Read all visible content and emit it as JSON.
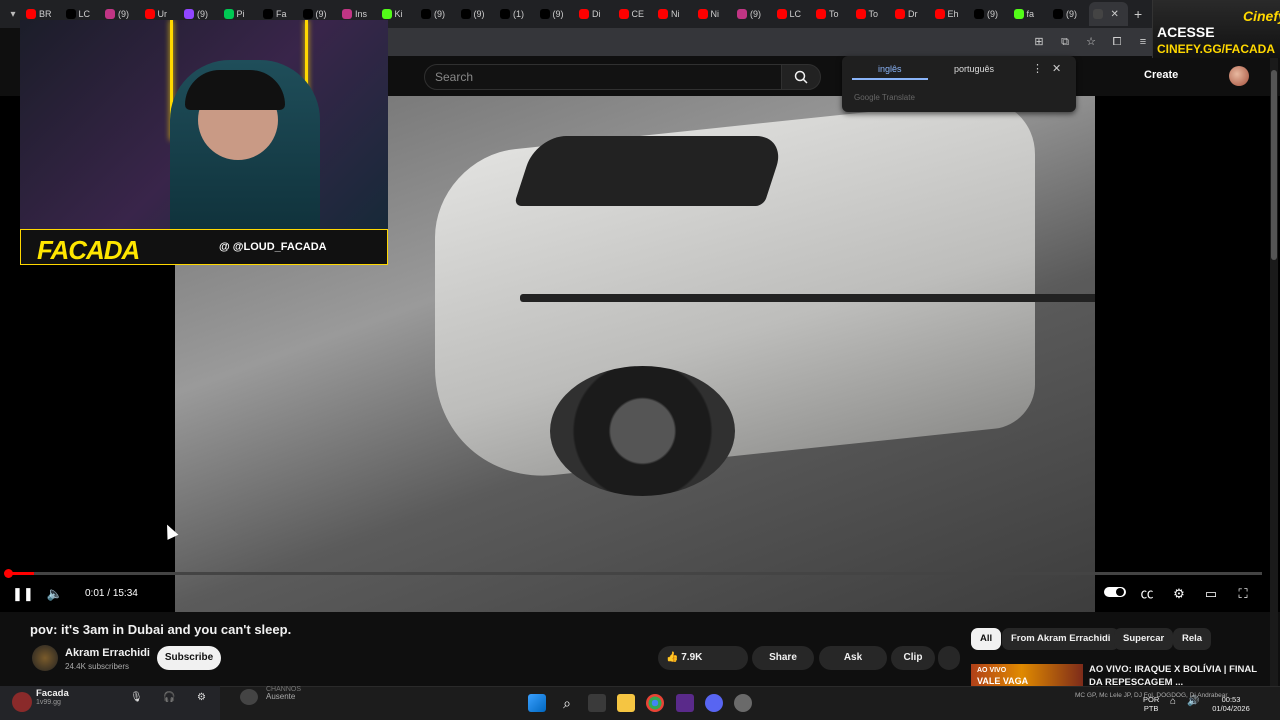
{
  "browser": {
    "tabs": [
      {
        "label": "BR",
        "color": "#ff0000",
        "icon": "youtube-icon"
      },
      {
        "label": "LC",
        "color": "#000000",
        "icon": "x-icon"
      },
      {
        "label": "(9)",
        "color": "#c13584",
        "icon": "instagram-icon"
      },
      {
        "label": "Ur",
        "color": "#ff0000",
        "icon": "youtube-icon"
      },
      {
        "label": "(9)",
        "color": "#9146ff",
        "icon": "twitch-icon"
      },
      {
        "label": "Pi",
        "color": "#00c853",
        "icon": "link-icon"
      },
      {
        "label": "Fa",
        "color": "#000000",
        "icon": "tiktok-icon"
      },
      {
        "label": "(9)",
        "color": "#000000",
        "icon": "tiktok-icon"
      },
      {
        "label": "Ins",
        "color": "#c13584",
        "icon": "instagram-icon"
      },
      {
        "label": "Ki",
        "color": "#53fc18",
        "icon": "kick-icon"
      },
      {
        "label": "(9)",
        "color": "#000000",
        "icon": "tiktok-icon"
      },
      {
        "label": "(9)",
        "color": "#000000",
        "icon": "tiktok-icon"
      },
      {
        "label": "(1)",
        "color": "#000000",
        "icon": "x-icon"
      },
      {
        "label": "(9)",
        "color": "#000000",
        "icon": "tiktok-icon"
      },
      {
        "label": "Di",
        "color": "#ff0000",
        "icon": "youtube-icon"
      },
      {
        "label": "CE",
        "color": "#ff0000",
        "icon": "youtube-icon"
      },
      {
        "label": "Ni",
        "color": "#ff0000",
        "icon": "youtube-icon"
      },
      {
        "label": "Ni",
        "color": "#ff0000",
        "icon": "youtube-icon"
      },
      {
        "label": "(9)",
        "color": "#c13584",
        "icon": "instagram-icon"
      },
      {
        "label": "LC",
        "color": "#ff0000",
        "icon": "youtube-icon"
      },
      {
        "label": "To",
        "color": "#ff0000",
        "icon": "youtube-icon"
      },
      {
        "label": "To",
        "color": "#ff0000",
        "icon": "youtube-icon"
      },
      {
        "label": "Dr",
        "color": "#ff0000",
        "icon": "youtube-icon"
      },
      {
        "label": "Eh",
        "color": "#ff0000",
        "icon": "youtube-icon"
      },
      {
        "label": "(9)",
        "color": "#000000",
        "icon": "tiktok-icon"
      },
      {
        "label": "fa",
        "color": "#53fc18",
        "icon": "kick-icon"
      },
      {
        "label": "(9)",
        "color": "#000000",
        "icon": "tiktok-icon"
      },
      {
        "label": "",
        "color": "#444444",
        "icon": "audio-icon",
        "active": true
      }
    ],
    "tab_close": "✕",
    "new_tab": "+"
  },
  "youtube": {
    "search_placeholder": "Search",
    "create_label": "Create",
    "video": {
      "title": "pov: it's 3am in Dubai and you can't sleep.",
      "current_time": "0:01",
      "separator": "/",
      "duration": "15:34",
      "progress": 0.001
    },
    "channel": {
      "name": "Akram Errachidi",
      "subscribers": "24.4K subscribers",
      "subscribe_label": "Subscribe"
    },
    "actions": {
      "likes": "7.9K",
      "share": "Share",
      "ask": "Ask",
      "clip": "Clip"
    },
    "chips": [
      "All",
      "From Akram Errachidi",
      "Supercar",
      "Rela"
    ],
    "recommended": {
      "badge": "AO VIVO",
      "thumb_text": "VALE VAGA",
      "title": "AO VIVO: IRAQUE X BOLÍVIA | FINAL DA REPESCAGEM ..."
    }
  },
  "translate_popup": {
    "lang_from": "inglês",
    "lang_to": "português",
    "brand": "Google Translate"
  },
  "stream_overlay": {
    "logo_text": "FACADA",
    "handle": "@ @LOUD_FACADA",
    "sponsor_acesse": "ACESSE",
    "sponsor_url": "CINEFY.GG/FACADA",
    "sponsor_logo": "Cinefy"
  },
  "discord": {
    "user_name": "Facada",
    "user_status": "1v99.gg",
    "other_user_status": "Ausente",
    "other_user_name": "CHANNOS"
  },
  "taskbar": {
    "media": "MC GP, Mc Lele JP, DJ Fol. DOGDOG, Dj Andrabear",
    "lang_1": "POR",
    "lang_2": "PTB",
    "time": "00:53",
    "date": "01/04/2026"
  }
}
